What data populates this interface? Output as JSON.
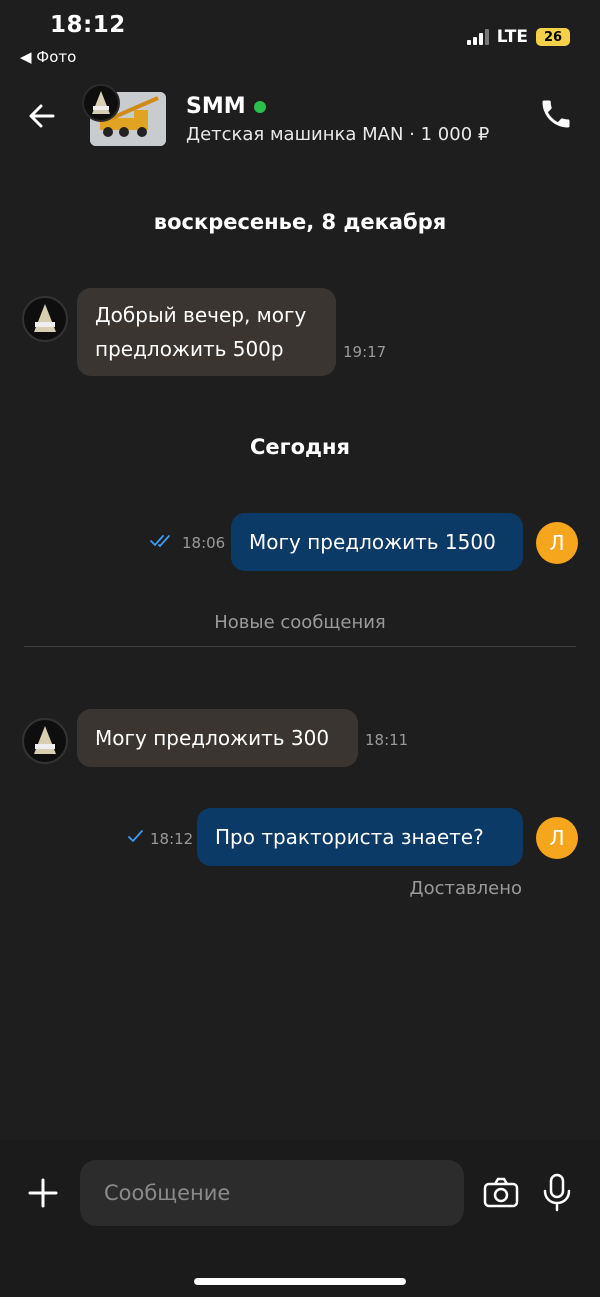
{
  "status_bar": {
    "time": "18:12",
    "back_label": "◀ Фото",
    "network": "LTE",
    "battery": "26"
  },
  "header": {
    "name": "SMM",
    "subtitle": "Детская машинка MAN · 1 000 ₽",
    "online_color": "#2bc04a"
  },
  "dates": {
    "first": "воскресенье, 8 декабря",
    "second": "Сегодня"
  },
  "messages": [
    {
      "line1": "Добрый вечер, могу",
      "line2": "предложить 500р",
      "time": "19:17"
    },
    {
      "text": "Могу предложить 1500",
      "time": "18:06",
      "status_icon": "double-check-icon"
    },
    {
      "text": "Могу предложить 300",
      "time": "18:11"
    },
    {
      "text": "Про тракториста  знаете?",
      "time": "18:12",
      "status_icon": "single-check-icon"
    }
  ],
  "user_initial": "Л",
  "new_messages_label": "Новые сообщения",
  "delivered_label": "Доставлено",
  "composer": {
    "placeholder": "Сообщение"
  },
  "colors": {
    "background": "#1e1e1e",
    "incoming_bubble": "#3a3530",
    "outgoing_bubble": "#0c3a66",
    "user_avatar": "#f6a61c",
    "check": "#3d9cf5"
  }
}
